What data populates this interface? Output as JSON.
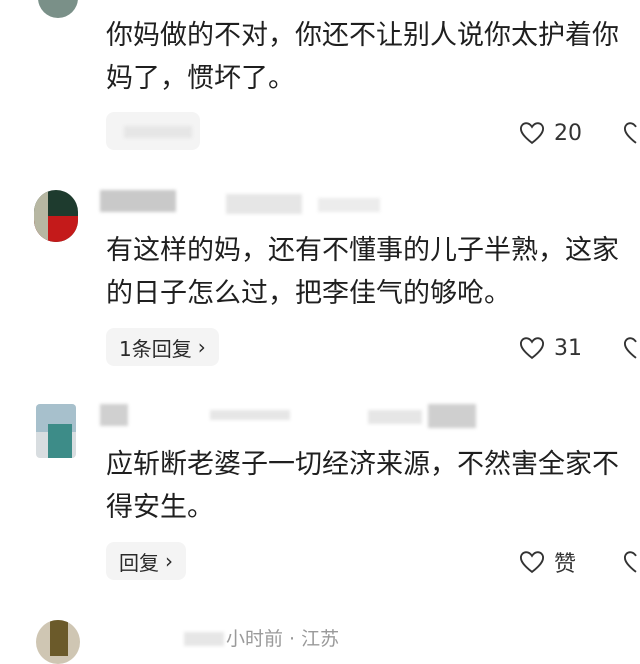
{
  "comments": [
    {
      "text_line1": "你妈做的不对，你还不让别人说你太护着你",
      "text_line2": "妈了，惯坏了。",
      "likes": "20"
    },
    {
      "text_line1": "有这样的妈，还有不懂事的儿子半熟，这家",
      "text_line2": "的日子怎么过，把李佳气的够呛。",
      "reply_label": "1条回复",
      "likes": "31"
    },
    {
      "text_line1": "应斩断老婆子一切经济来源，不然害全家不",
      "text_line2": "得安生。",
      "reply_label": "回复",
      "likes": "赞"
    }
  ],
  "partial_meta": "小时前 · 江苏",
  "colors": {
    "text": "#1f1f1f",
    "muted": "#9a9a9a",
    "pill_bg": "#f4f4f4"
  }
}
